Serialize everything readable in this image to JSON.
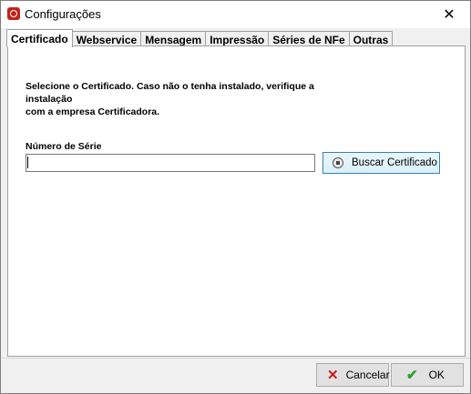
{
  "window": {
    "title": "Configurações"
  },
  "tabs": [
    {
      "label": "Certificado",
      "active": true
    },
    {
      "label": "Webservice",
      "active": false
    },
    {
      "label": "Mensagem",
      "active": false
    },
    {
      "label": "Impressão",
      "active": false
    },
    {
      "label": "Séries de NFe",
      "active": false
    },
    {
      "label": "Outras",
      "active": false
    }
  ],
  "certificado": {
    "instruction_line1": "Selecione o Certificado. Caso não o tenha instalado, verifique a instalação",
    "instruction_line2": "com a empresa Certificadora.",
    "serial_label": "Número de Série",
    "serial_value": "",
    "buscar_button_label": "Buscar Certificado"
  },
  "footer": {
    "cancel_label": "Cancelar",
    "ok_label": "OK"
  },
  "icons": {
    "app": "app-icon",
    "close": "close-icon",
    "lock": "lock-icon",
    "cancel": "x-icon",
    "ok": "check-icon"
  }
}
